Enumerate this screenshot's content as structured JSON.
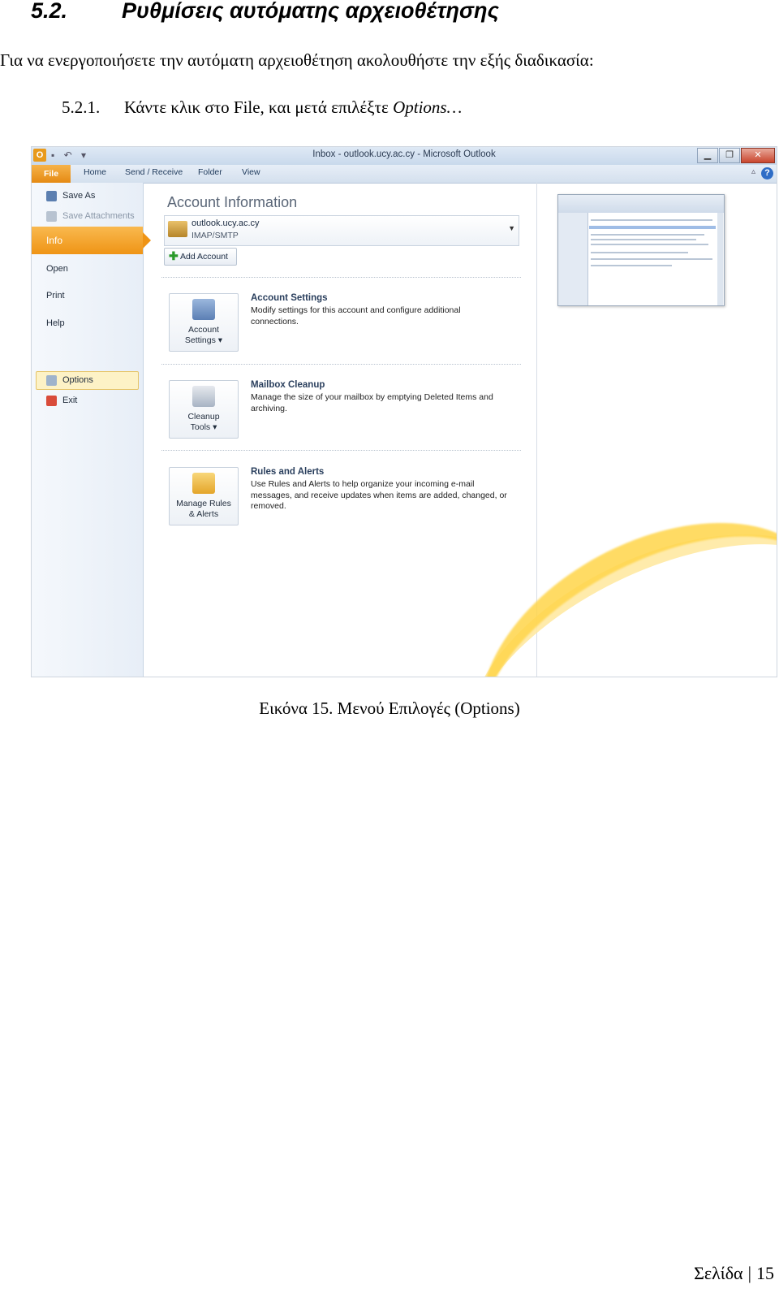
{
  "document": {
    "section_number": "5.2.",
    "section_title": "Ρυθμίσεις αυτόματης αρχειοθέτησης",
    "intro": "Για να ενεργοποιήσετε την αυτόματη αρχειοθέτηση ακολουθήστε την εξής διαδικασία:",
    "step_number": "5.2.1.",
    "step_text": "Κάντε κλικ στο File, και μετά επιλέξτε ",
    "step_emphasis": "Options…",
    "caption": "Εικόνα 15. Μενού Επιλογές (Options)",
    "footer_label": "Σελίδα",
    "footer_separator": "|",
    "page_number": "15"
  },
  "outlook": {
    "app_icon": "O",
    "qat": "▪ ↶ ▾",
    "window_title": "Inbox - outlook.ucy.ac.cy - Microsoft Outlook",
    "window_buttons": [
      "▁",
      "❐",
      "✕"
    ],
    "tabs": [
      "File",
      "Home",
      "Send / Receive",
      "Folder",
      "View"
    ],
    "help": "?",
    "ribbon_min": "▵",
    "nav": {
      "save_as": "Save As",
      "save_attachments": "Save Attachments",
      "info": "Info",
      "open": "Open",
      "print": "Print",
      "help": "Help",
      "options": "Options",
      "exit": "Exit"
    },
    "content_title": "Account Information",
    "account": {
      "name": "outlook.ucy.ac.cy",
      "type": "IMAP/SMTP",
      "arrow": "▼"
    },
    "add_account": "Add Account",
    "add_icon": "✚",
    "sections": [
      {
        "button": "Account\nSettings ▾",
        "title": "Account Settings",
        "desc": "Modify settings for this account and configure additional connections."
      },
      {
        "button": "Cleanup\nTools ▾",
        "title": "Mailbox Cleanup",
        "desc": "Manage the size of your mailbox by emptying Deleted Items and archiving."
      },
      {
        "button": "Manage Rules\n& Alerts",
        "title": "Rules and Alerts",
        "desc": "Use Rules and Alerts to help organize your incoming e-mail messages, and receive updates when items are added, changed, or removed."
      }
    ]
  }
}
